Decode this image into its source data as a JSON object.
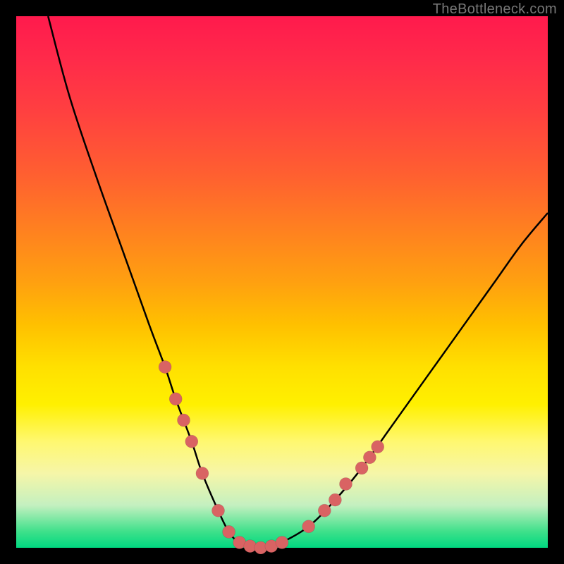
{
  "watermark": "TheBottleneck.com",
  "palette": {
    "gradient_top": "#ff1a4d",
    "gradient_bottom": "#00d880",
    "curve": "#000000",
    "marker": "#d96363",
    "frame_bg": "#000000"
  },
  "chart_data": {
    "type": "line",
    "title": "",
    "xlabel": "",
    "ylabel": "",
    "xlim": [
      0,
      100
    ],
    "ylim": [
      0,
      100
    ],
    "series": [
      {
        "name": "bottleneck-curve",
        "x": [
          6,
          10,
          15,
          20,
          25,
          28,
          30,
          33,
          35,
          38,
          40,
          42,
          45,
          48,
          50,
          55,
          60,
          65,
          70,
          75,
          80,
          85,
          90,
          95,
          100
        ],
        "y": [
          100,
          85,
          70,
          56,
          42,
          34,
          28,
          20,
          14,
          7,
          3,
          1,
          0,
          0,
          1,
          4,
          9,
          15,
          22,
          29,
          36,
          43,
          50,
          57,
          63
        ]
      }
    ],
    "markers": {
      "name": "highlight-points",
      "points": [
        {
          "x": 28,
          "y": 34
        },
        {
          "x": 30,
          "y": 28
        },
        {
          "x": 31.5,
          "y": 24
        },
        {
          "x": 33,
          "y": 20
        },
        {
          "x": 35,
          "y": 14
        },
        {
          "x": 38,
          "y": 7
        },
        {
          "x": 40,
          "y": 3
        },
        {
          "x": 42,
          "y": 1
        },
        {
          "x": 44,
          "y": 0.3
        },
        {
          "x": 46,
          "y": 0
        },
        {
          "x": 48,
          "y": 0.3
        },
        {
          "x": 50,
          "y": 1
        },
        {
          "x": 55,
          "y": 4
        },
        {
          "x": 58,
          "y": 7
        },
        {
          "x": 60,
          "y": 9
        },
        {
          "x": 62,
          "y": 12
        },
        {
          "x": 65,
          "y": 15
        },
        {
          "x": 66.5,
          "y": 17
        },
        {
          "x": 68,
          "y": 19
        }
      ]
    }
  }
}
